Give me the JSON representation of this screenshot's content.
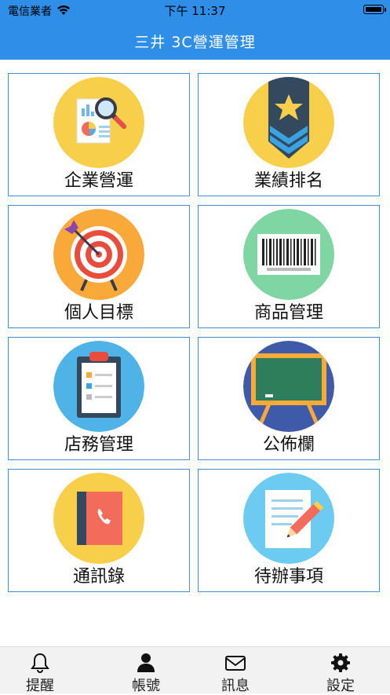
{
  "status_bar": {
    "carrier": "電信業者",
    "time": "下午 11:37"
  },
  "nav": {
    "title": "三井 3C營運管理"
  },
  "tiles": [
    {
      "label": "企業營運",
      "icon": "report-magnifier-icon"
    },
    {
      "label": "業績排名",
      "icon": "rank-badge-icon"
    },
    {
      "label": "個人目標",
      "icon": "target-icon"
    },
    {
      "label": "商品管理",
      "icon": "barcode-icon"
    },
    {
      "label": "店務管理",
      "icon": "clipboard-icon"
    },
    {
      "label": "公佈欄",
      "icon": "chalkboard-icon"
    },
    {
      "label": "通訊錄",
      "icon": "address-book-icon"
    },
    {
      "label": "待辦事項",
      "icon": "todo-pencil-icon"
    }
  ],
  "tabs": [
    {
      "label": "提醒",
      "icon": "bell-icon"
    },
    {
      "label": "帳號",
      "icon": "user-icon"
    },
    {
      "label": "訊息",
      "icon": "envelope-icon"
    },
    {
      "label": "設定",
      "icon": "gear-icon"
    }
  ]
}
